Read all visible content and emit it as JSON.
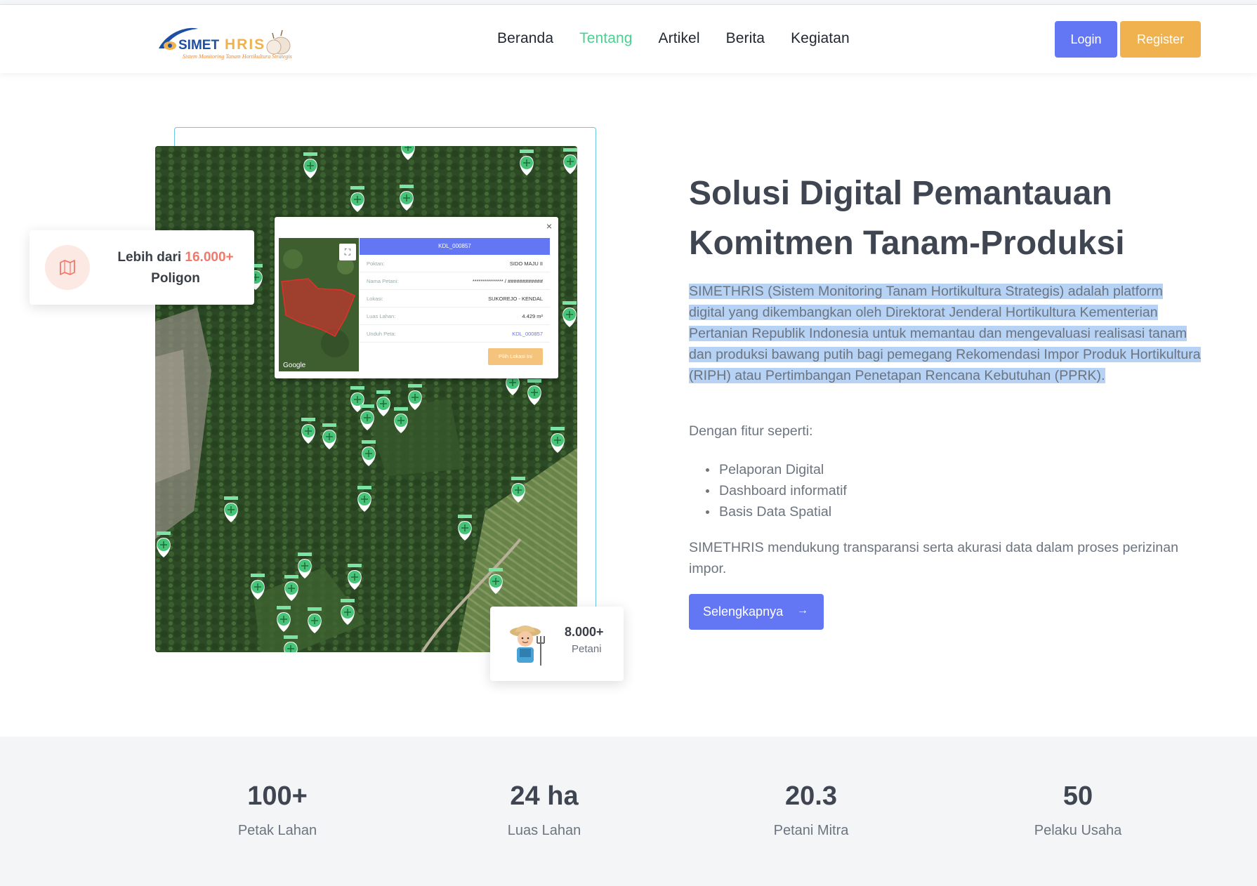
{
  "nav": {
    "logo_text": "SIMETHRIS",
    "logo_tagline": "Sistem Monitoring Tanam Hortikultura Strategis",
    "links": [
      {
        "label": "Beranda"
      },
      {
        "label": "Tentang"
      },
      {
        "label": "Artikel"
      },
      {
        "label": "Berita"
      },
      {
        "label": "Kegiatan"
      }
    ],
    "active_link": "Tentang",
    "login_label": "Login",
    "register_label": "Register"
  },
  "map_popup": {
    "header": "KDL_000857",
    "rows": [
      {
        "key": "Poktan:",
        "value": "SIDO MAJU II"
      },
      {
        "key": "Nama Petani:",
        "value": "*************** / ############"
      },
      {
        "key": "Lokasi:",
        "value": "SUKOREJO - KENDAL"
      },
      {
        "key": "Luas Lahan:",
        "value": "4.429 m²"
      },
      {
        "key": "Unduh Peta:",
        "value": "KDL_000857"
      }
    ],
    "button_label": "Pilih Lokasi Ini",
    "close_symbol": "×",
    "google_label": "Google"
  },
  "card_polygon": {
    "prefix": "Lebih dari",
    "highlight": "16.000+",
    "suffix": "Poligon"
  },
  "card_farmer": {
    "value": "8.000+",
    "label": "Petani"
  },
  "hero": {
    "title": "Solusi Digital Pemantauan Komitmen Tanam-Produksi",
    "description": "SIMETHRIS (Sistem Monitoring Tanam Hortikultura Strategis) adalah platform digital yang dikembangkan oleh Direktorat Jenderal Hortikultura Kementerian Pertanian Republik Indonesia untuk memantau dan mengevaluasi realisasi tanam dan produksi bawang putih bagi pemegang Rekomendasi Impor Produk Hortikultura (RIPH) atau Pertimbangan Penetapan Rencana Kebutuhan (PPRK).",
    "subheading": "Dengan fitur seperti:",
    "features": [
      "Pelaporan Digital",
      "Dashboard informatif",
      "Basis Data Spatial"
    ],
    "footer": "SIMETHRIS mendukung transparansi serta akurasi data dalam proses perizinan impor.",
    "button_label": "Selengkapnya",
    "button_arrow": "→"
  },
  "stats": [
    {
      "value": "100+",
      "label": "Petak Lahan"
    },
    {
      "value": "24 ha",
      "label": "Luas Lahan"
    },
    {
      "value": "20.3",
      "label": "Petani Mitra"
    },
    {
      "value": "50",
      "label": "Pelaku Usaha"
    }
  ],
  "colors": {
    "primary": "#6377f4",
    "accent": "#f0b24f",
    "active_nav": "#4ccf8f",
    "highlight_number": "#f0796a",
    "selection": "#b6d2f5"
  }
}
